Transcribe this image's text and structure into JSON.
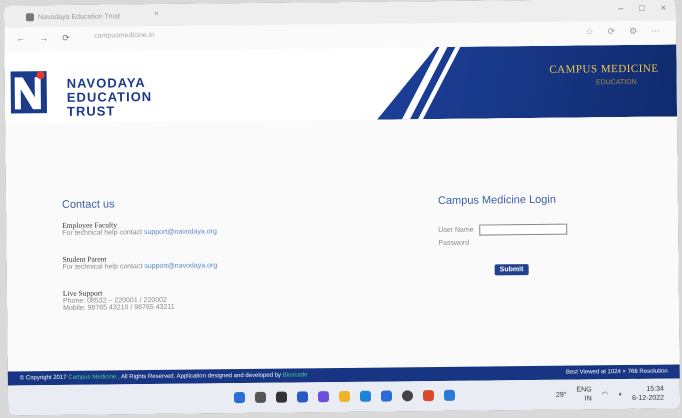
{
  "browser": {
    "tab_title": "Navodaya Education Trust",
    "tab_close": "×",
    "window_controls": [
      "–",
      "□",
      "×"
    ],
    "nav": [
      "←",
      "→",
      "⟳"
    ],
    "url": "campusmedicine.in",
    "toolbar_right": [
      "☆",
      "⟳",
      "⚙",
      "⋯"
    ]
  },
  "header": {
    "brand_lines": [
      "NAVODAYA",
      "EDUCATION",
      "TRUST"
    ],
    "right_title": "CAMPUS MEDICINE",
    "right_subtitle": "EDUCATION"
  },
  "contact": {
    "title": "Contact us",
    "employee_heading": "Employee Faculty",
    "employee_line_prefix": "For technical help contact ",
    "employee_email": "support@navodaya.org",
    "student_heading": "Student Parent",
    "student_line_prefix": "For technical help contact ",
    "student_email": "support@navodaya.org",
    "live_heading": "Live Support",
    "live_line1": "Phone: 08532 – 220001 / 220002",
    "live_line2": "Mobile: 98765 43210 / 98765 43211"
  },
  "login": {
    "title": "Campus Medicine Login",
    "user_label": "User Name",
    "password_label": "Password",
    "submit": "Submit"
  },
  "footer": {
    "left_prefix": "© Copyright 2017",
    "left_brand": "Campus Medicine",
    "left_rest": ". All Rights Reserved. Application designed and developed by",
    "left_dev": "Bioscade",
    "right": "Best Viewed at 1024 × 768 Resolution"
  },
  "taskbar": {
    "weather": "29°",
    "lang_top": "ENG",
    "lang_bottom": "IN",
    "time": "15:34",
    "date": "6-12-2022"
  },
  "colors": {
    "brand_blue": "#1b3a8a",
    "header_band": "#173582",
    "gold": "#f2c84b",
    "link": "#5a87c4"
  }
}
